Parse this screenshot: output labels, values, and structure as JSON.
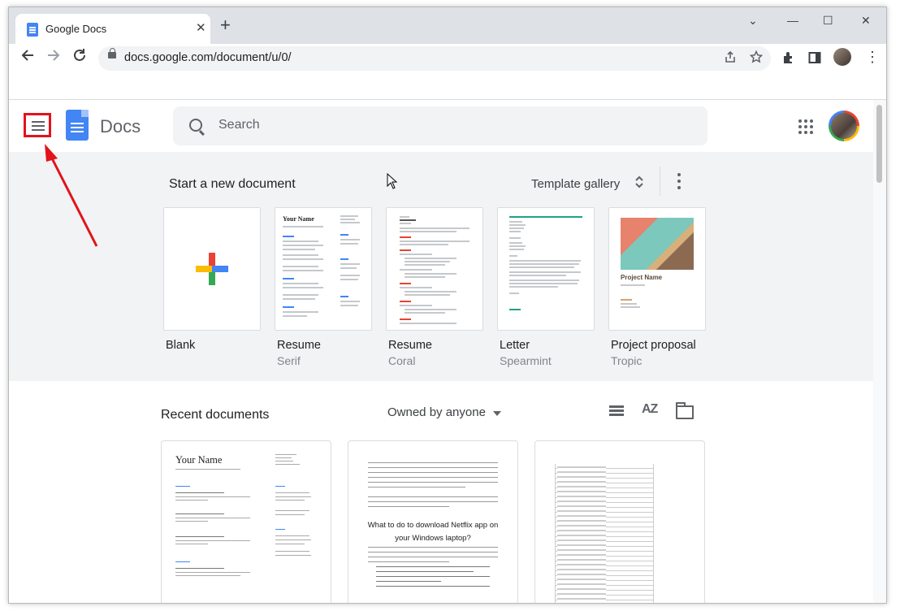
{
  "browser": {
    "tab_title": "Google Docs",
    "tab_close": "✕",
    "new_tab": "+",
    "url": "docs.google.com/document/u/0/",
    "win_min": "⌄",
    "win_minimize": "—",
    "win_restore": "☐",
    "win_close": "✕"
  },
  "app": {
    "title": "Docs",
    "search_placeholder": "Search"
  },
  "templates": {
    "heading": "Start a new document",
    "gallery_label": "Template gallery",
    "items": [
      {
        "name": "Blank",
        "sub": ""
      },
      {
        "name": "Resume",
        "sub": "Serif",
        "preview_title": "Your Name"
      },
      {
        "name": "Resume",
        "sub": "Coral"
      },
      {
        "name": "Letter",
        "sub": "Spearmint"
      },
      {
        "name": "Project proposal",
        "sub": "Tropic",
        "preview_title": "Project Name"
      }
    ]
  },
  "recent": {
    "heading": "Recent documents",
    "owner_filter": "Owned by anyone",
    "sort_label": "AZ",
    "docs": [
      {
        "preview_title": "Your Name"
      },
      {
        "preview_title": "What to do to download Netflix app on your Windows laptop?"
      },
      {
        "preview_title": ""
      }
    ]
  },
  "colors": {
    "accent_blue": "#4285f4",
    "highlight_red": "#e2131b",
    "template_bg": "#f1f3f4"
  }
}
